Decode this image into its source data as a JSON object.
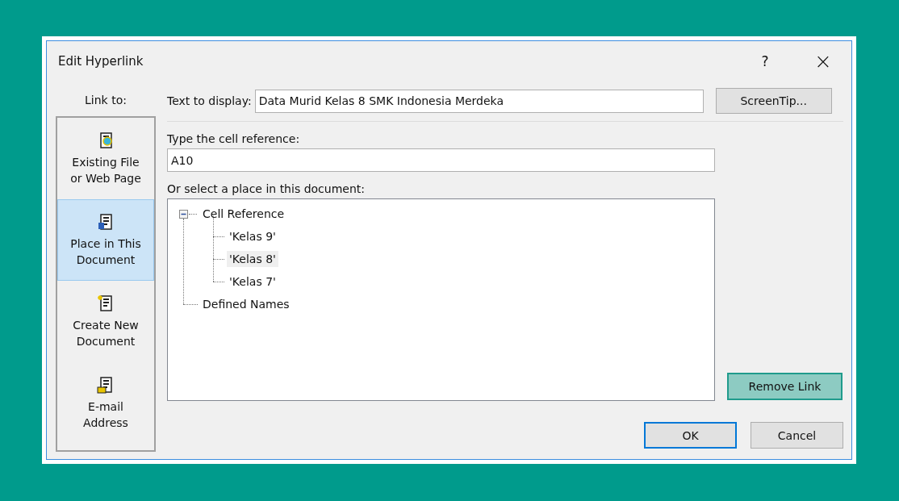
{
  "window": {
    "title": "Edit Hyperlink",
    "help": "?",
    "close": "×"
  },
  "link_to": {
    "label": "Link to:",
    "items": [
      {
        "label": "Existing File or Web Page",
        "selected": false
      },
      {
        "label": "Place in This Document",
        "selected": true
      },
      {
        "label": "Create New Document",
        "selected": false
      },
      {
        "label": "E-mail Address",
        "selected": false
      }
    ]
  },
  "text_to_display": {
    "label": "Text to display:",
    "value": "Data Murid Kelas 8 SMK Indonesia Merdeka"
  },
  "screentip_button": "ScreenTip...",
  "cell_reference": {
    "label": "Type the cell reference:",
    "value": "A10"
  },
  "place": {
    "label": "Or select a place in this document:",
    "tree": [
      {
        "label": "Cell Reference",
        "expanded": true,
        "selected": false,
        "children": [
          {
            "label": "'Kelas 9'",
            "selected": false
          },
          {
            "label": "'Kelas 8'",
            "selected": true
          },
          {
            "label": "'Kelas 7'",
            "selected": false
          }
        ]
      },
      {
        "label": "Defined Names",
        "selected": false
      }
    ]
  },
  "remove_link_button": {
    "label": "Remove Link",
    "highlighted": true
  },
  "buttons": [
    {
      "label": "OK",
      "default": true
    },
    {
      "label": "Cancel",
      "default": false
    }
  ]
}
